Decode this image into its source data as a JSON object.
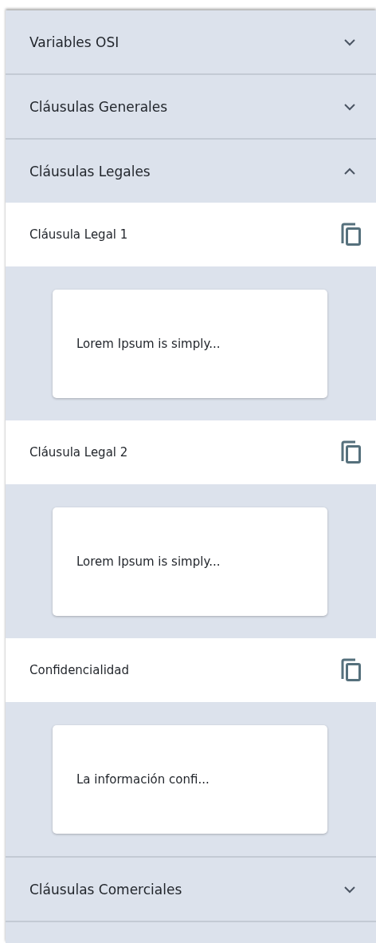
{
  "sections": [
    {
      "title": "Variables OSI",
      "expanded": false
    },
    {
      "title": "Cláusulas Generales",
      "expanded": false
    },
    {
      "title": "Cláusulas Legales",
      "expanded": true,
      "items": [
        {
          "title": "Cláusula Legal 1",
          "preview": "Lorem Ipsum is simply..."
        },
        {
          "title": "Cláusula Legal 2",
          "preview": "Lorem Ipsum is simply..."
        },
        {
          "title": "Confidencialidad",
          "preview": "La información confi..."
        }
      ]
    },
    {
      "title": "Cláusulas Comerciales",
      "expanded": false
    }
  ]
}
